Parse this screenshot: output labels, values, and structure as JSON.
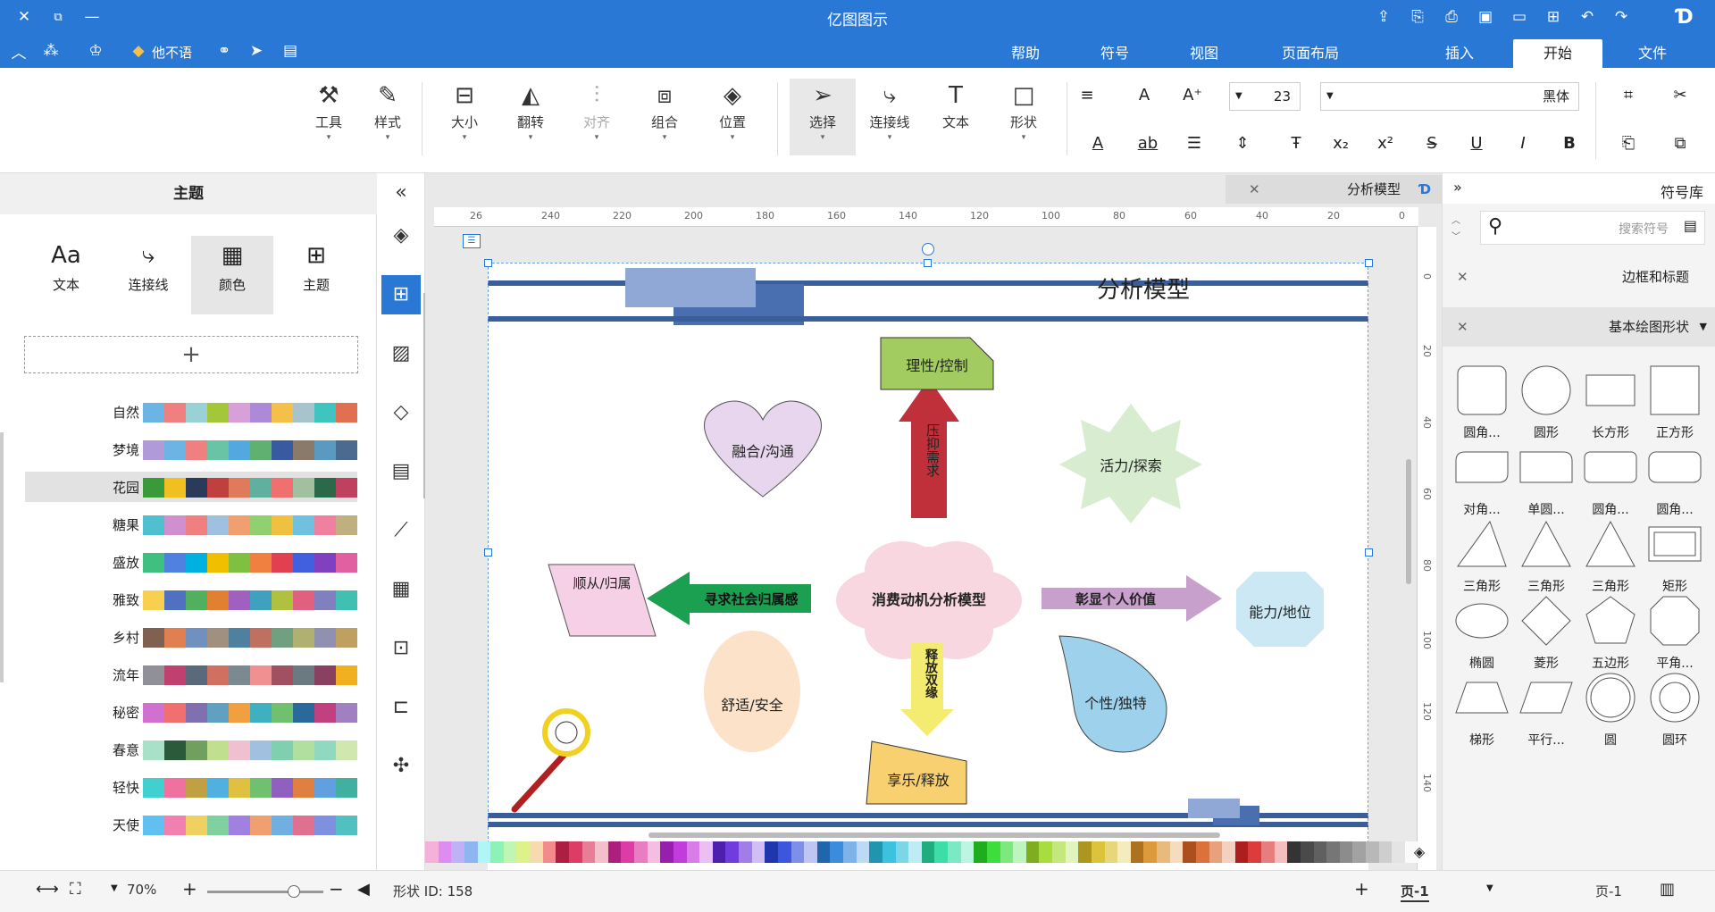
{
  "titlebar": {
    "title": "亿图图示",
    "icons_right": [
      "edraw-logo-icon",
      "redo-icon",
      "undo-icon",
      "new-icon",
      "open-icon",
      "save-icon",
      "print-icon",
      "export-icon",
      "share-icon"
    ],
    "icons_left": [
      "close-icon",
      "restore-icon",
      "minimize-icon"
    ]
  },
  "menubar": {
    "tabs": [
      "文件",
      "开始",
      "插入",
      "页面布局",
      "视图",
      "符号",
      "帮助"
    ],
    "active_tab": "开始",
    "user_label": "他不语"
  },
  "ribbon": {
    "font_name": "黑体",
    "font_size": "23",
    "buttons": {
      "shape": "形状",
      "text": "文本",
      "connector": "连接线",
      "select": "选择",
      "position": "位置",
      "group": "组合",
      "align": "对齐",
      "flip": "翻转",
      "size": "大小",
      "style": "样式",
      "tools": "工具"
    }
  },
  "left_panel": {
    "title": "主题",
    "tabs": [
      {
        "icon": "grid-icon",
        "label": "主题"
      },
      {
        "icon": "palette-icon",
        "label": "颜色"
      },
      {
        "icon": "connector-icon",
        "label": "连接线"
      },
      {
        "icon": "Aa",
        "label": "文本"
      }
    ],
    "active_tab": "颜色",
    "add_label": "+",
    "palettes": [
      {
        "name": "自然",
        "colors": [
          "#6cb4e4",
          "#f08080",
          "#9ad1d4",
          "#a4c639",
          "#d8a0d8",
          "#ad8ad8",
          "#f4c04a",
          "#a7c4cc",
          "#40c4c0",
          "#e07050"
        ]
      },
      {
        "name": "梦境",
        "colors": [
          "#b09ad8",
          "#6cb4e4",
          "#f08080",
          "#68c4a4",
          "#54a8e0",
          "#60b070",
          "#3a5aa0",
          "#8a7a6a",
          "#5a9ac0",
          "#4a6a90"
        ]
      },
      {
        "name": "花园",
        "colors": [
          "#3a9a3a",
          "#f0c020",
          "#2a3a5a",
          "#c04040",
          "#e07a5a",
          "#60b0a0",
          "#f07070",
          "#a0c0a0",
          "#2a6a4a",
          "#c04060"
        ]
      },
      {
        "name": "糖果",
        "colors": [
          "#50c0d0",
          "#d090d0",
          "#f08080",
          "#a0c0e0",
          "#f0a070",
          "#90d070",
          "#f0c040",
          "#70c0e0",
          "#f080a0",
          "#c0b080"
        ]
      },
      {
        "name": "盛放",
        "colors": [
          "#40c080",
          "#5080e0",
          "#00b0e0",
          "#f0c000",
          "#80c040",
          "#f08040",
          "#e04050",
          "#4060e0",
          "#8040c0",
          "#e060a0"
        ]
      },
      {
        "name": "雅致",
        "colors": [
          "#f8d050",
          "#5070c0",
          "#50b060",
          "#e08030",
          "#a060c0",
          "#40a0c0",
          "#b0c040",
          "#e06080",
          "#8080c0",
          "#40c0b0"
        ]
      },
      {
        "name": "乡村",
        "colors": [
          "#806050",
          "#e08050",
          "#7090c0",
          "#a09080",
          "#5080a0",
          "#c07060",
          "#70a080",
          "#b0b070",
          "#9090b0",
          "#c0a060"
        ]
      },
      {
        "name": "流年",
        "colors": [
          "#909098",
          "#c04070",
          "#5a6a7a",
          "#d07060",
          "#7a8a90",
          "#f09090",
          "#a05060",
          "#6a7a80",
          "#8a4060",
          "#f0b020"
        ]
      },
      {
        "name": "秘密",
        "colors": [
          "#d070d0",
          "#f07070",
          "#8070b0",
          "#60a0c0",
          "#f0a040",
          "#40b0c0",
          "#70c070",
          "#2a6a9a",
          "#c04080",
          "#a080c0"
        ]
      },
      {
        "name": "春意",
        "colors": [
          "#a8e0c8",
          "#2a5a3a",
          "#70a060",
          "#c0e090",
          "#f0c0d0",
          "#a0c0e0",
          "#80d0b0",
          "#b0e0a0",
          "#90d8c0",
          "#d0e8b0"
        ]
      },
      {
        "name": "轻快",
        "colors": [
          "#40d0d0",
          "#f070a0",
          "#c0a040",
          "#50b0e0",
          "#e0c040",
          "#70c070",
          "#9060c0",
          "#e08040",
          "#60a0e0",
          "#40b0a0"
        ]
      },
      {
        "name": "天使",
        "colors": [
          "#60c0f0",
          "#f080b0",
          "#f0d060",
          "#80d0a0",
          "#a080e0",
          "#f0a070",
          "#70b0e0",
          "#e07090",
          "#8090e0",
          "#50c0c0"
        ]
      }
    ]
  },
  "left_toolbar": {
    "items": [
      "collapse-icon",
      "fill-icon",
      "theme-icon",
      "image-icon",
      "layers-icon",
      "page-icon",
      "chart-icon",
      "table-icon",
      "org-icon",
      "timeline-icon",
      "mindmap-icon"
    ],
    "active_index": 2
  },
  "canvas": {
    "doc_tab": "分析模型",
    "ruler_top": [
      "0",
      "20",
      "40",
      "60",
      "80",
      "100",
      "120",
      "140",
      "160",
      "180",
      "200",
      "220",
      "240",
      "26"
    ],
    "ruler_left": [
      "0",
      "20",
      "40",
      "60",
      "80",
      "100",
      "120",
      "140"
    ],
    "diagram": {
      "title": "分析模型",
      "center": "消费动机分析模型",
      "nodes": {
        "top": "理性/控制",
        "arrow_up": "压抑需求",
        "top_left": "融合/沟通",
        "top_right": "活力/探索",
        "arrow_left": "寻求社会归属感",
        "left": "顺从/归属",
        "arrow_right": "彰显个人价值",
        "right": "能力/地位",
        "arrow_down": "释放双缘",
        "bottom_left": "舒适/安全",
        "bottom_right": "个性/独特",
        "bottom": "享乐/释放"
      }
    }
  },
  "right_panel": {
    "title": "符号库",
    "search_placeholder": "搜索符号",
    "sections": [
      {
        "label": "边框和标题",
        "expanded": false
      },
      {
        "label": "基本绘图形状",
        "expanded": true
      }
    ],
    "shapes": [
      "正方形",
      "长方形",
      "圆形",
      "圆角...",
      "圆角...",
      "圆角...",
      "单圆...",
      "对角...",
      "矩形",
      "三角形",
      "三角形",
      "三角形",
      "平角...",
      "五边形",
      "菱形",
      "椭圆",
      "圆环",
      "圆",
      "平行...",
      "梯形"
    ]
  },
  "statusbar": {
    "page_label": "页-1",
    "page_tab": "页-1",
    "shape_id": "形状 ID: 158",
    "zoom": "70%"
  },
  "colors": {
    "accent": "#2a78d6",
    "title_bar": "#3a5f98",
    "center_flower": "#f8d7e0",
    "up_arrow": "#c0303a",
    "left_arrow": "#1aa050",
    "right_arrow": "#c090c0",
    "down_arrow": "#f0e860"
  }
}
